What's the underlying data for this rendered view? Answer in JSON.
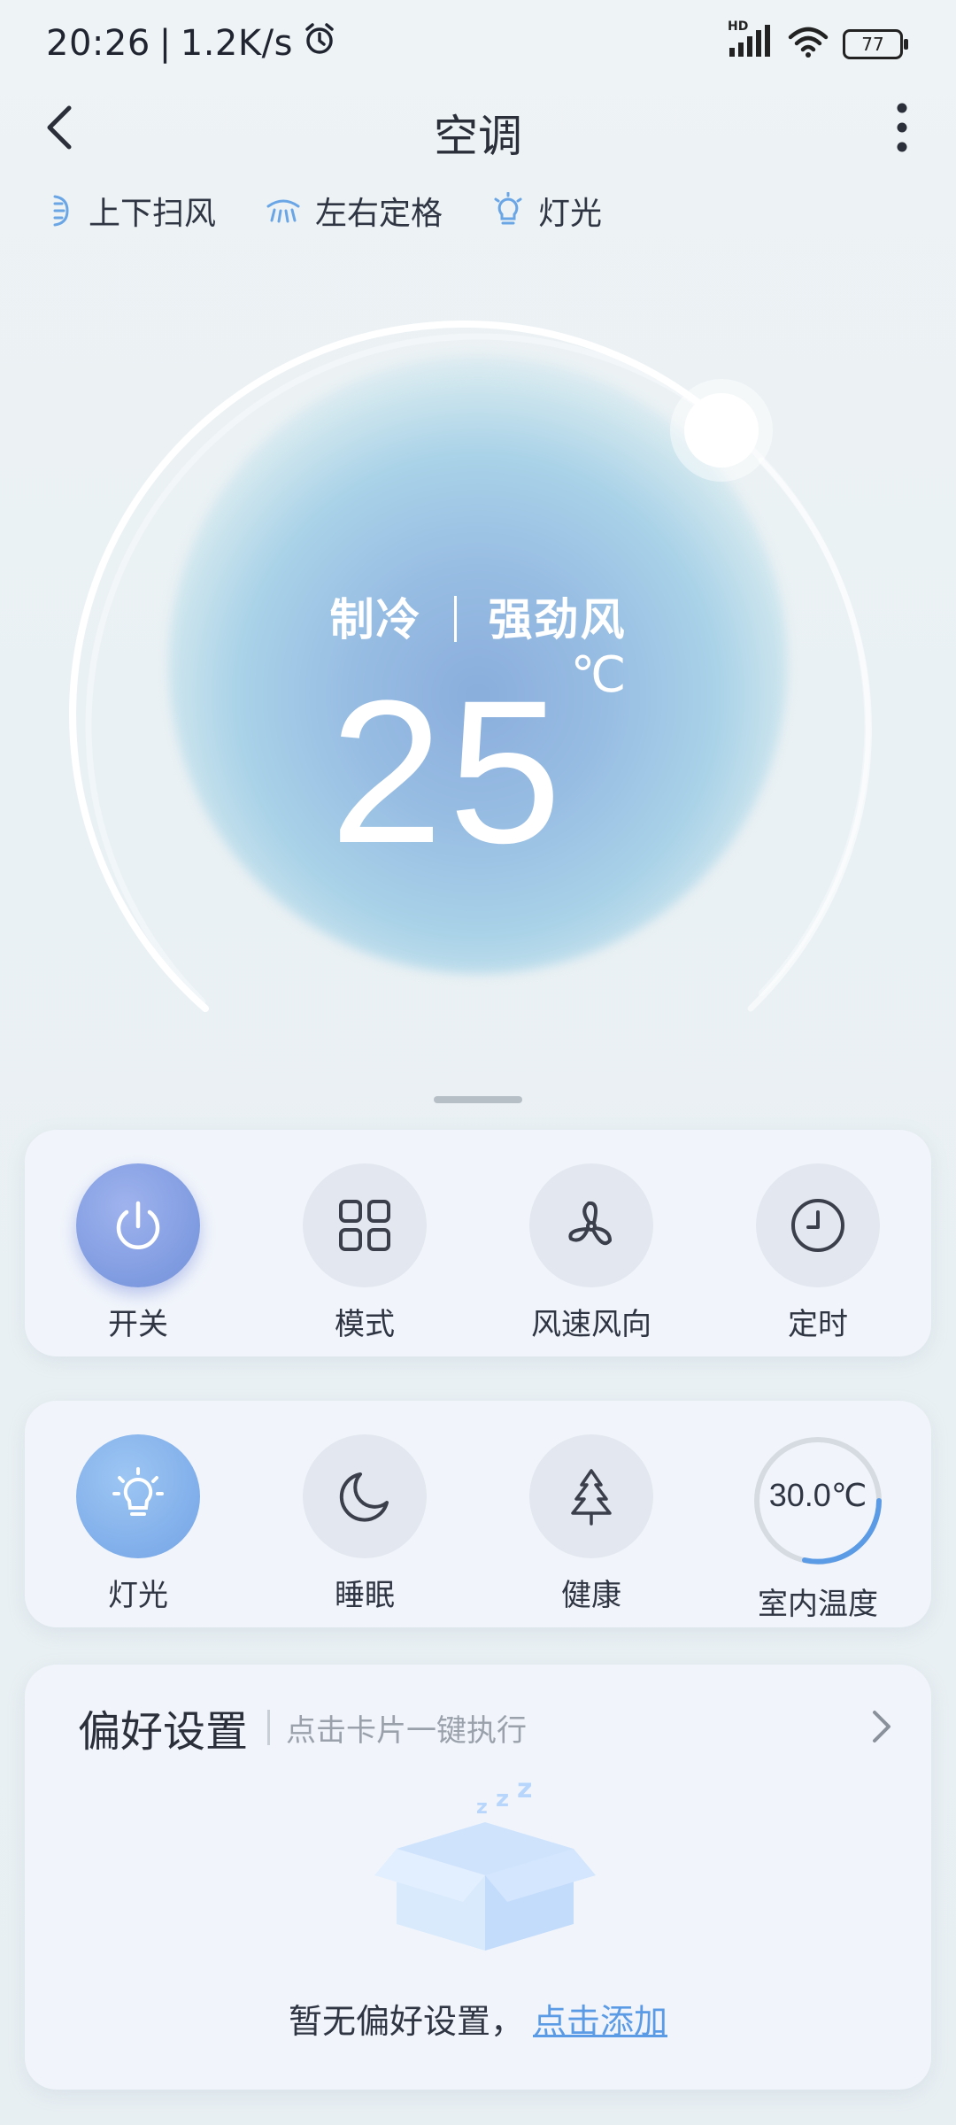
{
  "status_bar": {
    "time": "20:26",
    "separator": "|",
    "network_speed": "1.2K/s",
    "hd_label": "HD",
    "battery_level": "77"
  },
  "header": {
    "title": "空调"
  },
  "quick_toggles": [
    {
      "label": "上下扫风",
      "icon": "vertical-swing-icon"
    },
    {
      "label": "左右定格",
      "icon": "horizontal-swing-icon"
    },
    {
      "label": "灯光",
      "icon": "bulb-icon"
    }
  ],
  "dial": {
    "mode": "制冷",
    "fan_speed": "强劲风",
    "temperature": "25",
    "unit": "℃",
    "accent_color": "#8aaedc"
  },
  "controls_row1": [
    {
      "label": "开关",
      "icon": "power-icon",
      "active": true
    },
    {
      "label": "模式",
      "icon": "grid-icon",
      "active": false
    },
    {
      "label": "风速风向",
      "icon": "fan-icon",
      "active": false
    },
    {
      "label": "定时",
      "icon": "clock-icon",
      "active": false
    }
  ],
  "controls_row2": [
    {
      "label": "灯光",
      "icon": "bulb-icon",
      "active": true
    },
    {
      "label": "睡眠",
      "icon": "moon-icon",
      "active": false
    },
    {
      "label": "健康",
      "icon": "tree-icon",
      "active": false
    },
    {
      "label": "室内温度",
      "value": "30.0℃"
    }
  ],
  "preferences": {
    "title": "偏好设置",
    "subtitle": "点击卡片一键执行",
    "empty_text": "暂无偏好设置，",
    "add_link": "点击添加",
    "link_color": "#5b9be6"
  }
}
